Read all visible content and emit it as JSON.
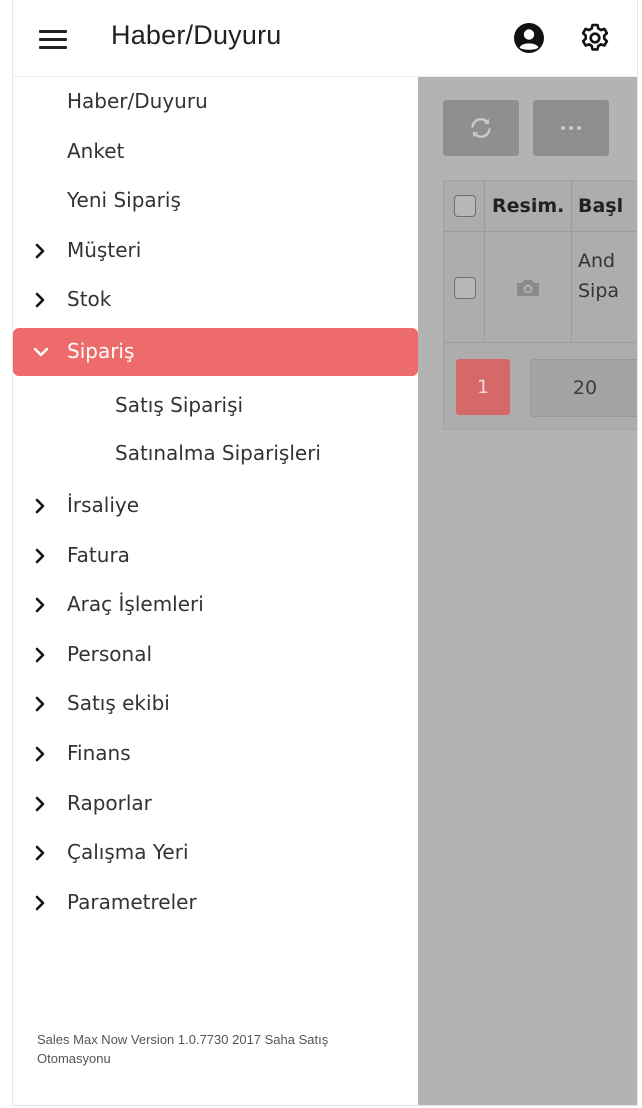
{
  "header": {
    "title": "Haber/Duyuru",
    "icons": {
      "menu": "hamburger-icon",
      "user": "user-circle-icon",
      "settings": "gear-icon"
    }
  },
  "menu": {
    "items": [
      {
        "label": "Haber/Duyuru",
        "kind": "plain"
      },
      {
        "label": "Anket",
        "kind": "plain"
      },
      {
        "label": "Yeni Sipariş",
        "kind": "plain"
      },
      {
        "label": "Müşteri",
        "kind": "group"
      },
      {
        "label": "Stok",
        "kind": "group"
      },
      {
        "label": "Sipariş",
        "kind": "group",
        "expanded": true,
        "active": true
      },
      {
        "label": "Satış Siparişi",
        "kind": "sub"
      },
      {
        "label": "Satınalma Siparişleri",
        "kind": "sub"
      },
      {
        "label": "İrsaliye",
        "kind": "group"
      },
      {
        "label": "Fatura",
        "kind": "group"
      },
      {
        "label": "Araç İşlemleri",
        "kind": "group"
      },
      {
        "label": "Personal",
        "kind": "group"
      },
      {
        "label": "Satış ekibi",
        "kind": "group"
      },
      {
        "label": "Finans",
        "kind": "group"
      },
      {
        "label": "Raporlar",
        "kind": "group"
      },
      {
        "label": "Çalışma Yeri",
        "kind": "group"
      },
      {
        "label": "Parametreler",
        "kind": "group"
      }
    ],
    "version_text": "Sales Max Now Version 1.0.7730 2017 Saha Satış Otomasyonu"
  },
  "grid": {
    "toolbar": {
      "refresh_icon": "refresh-icon",
      "more_label": "···"
    },
    "columns": [
      "Resim.",
      "Başl"
    ],
    "rows": [
      {
        "image_icon": "camera-icon",
        "title_line1": "And",
        "title_line2": "Sipa"
      }
    ],
    "pager": {
      "current_page": "1",
      "page_size": "20"
    }
  },
  "colors": {
    "accent": "#ee6b6b",
    "overlay": "#b3b3b3",
    "text": "#333333"
  }
}
